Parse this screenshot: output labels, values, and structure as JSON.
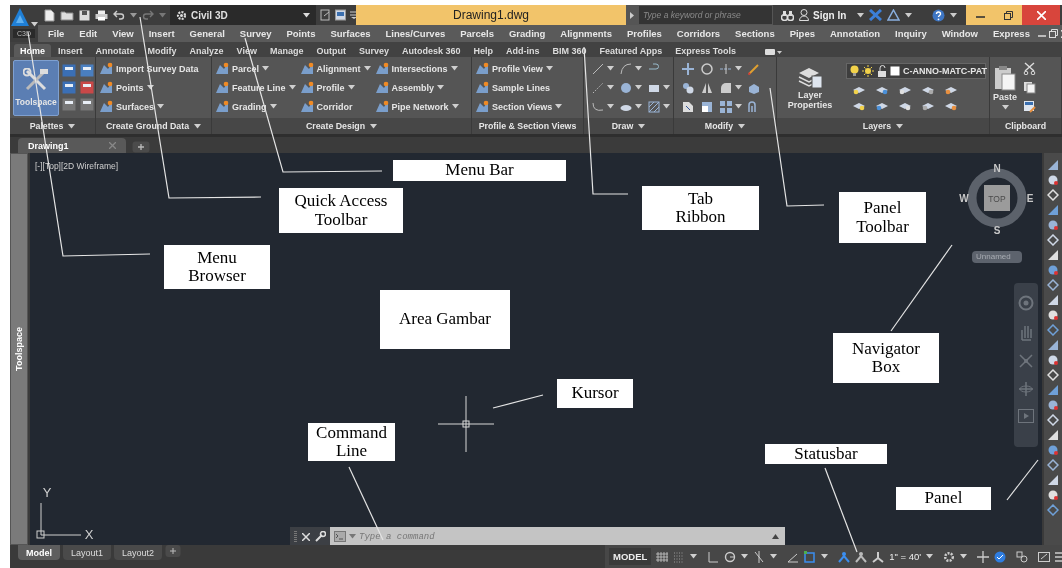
{
  "title_bar": {
    "app_badge": "C3D",
    "workspace": "Civil 3D",
    "title": "Drawing1.dwg",
    "search": {
      "placeholder": "Type a keyword or phrase"
    },
    "sign_in": "Sign In"
  },
  "menu_bar": [
    "File",
    "Edit",
    "View",
    "Insert",
    "General",
    "Survey",
    "Points",
    "Surfaces",
    "Lines/Curves",
    "Parcels",
    "Grading",
    "Alignments",
    "Profiles",
    "Corridors",
    "Sections",
    "Pipes",
    "Annotation",
    "Inquiry",
    "Window",
    "Express"
  ],
  "ribbon": {
    "tabs": [
      {
        "label": "Home",
        "selected": true
      },
      {
        "label": "Insert",
        "selected": false
      },
      {
        "label": "Annotate",
        "selected": false
      },
      {
        "label": "Modify",
        "selected": false
      },
      {
        "label": "Analyze",
        "selected": false
      },
      {
        "label": "View",
        "selected": false
      },
      {
        "label": "Manage",
        "selected": false
      },
      {
        "label": "Output",
        "selected": false
      },
      {
        "label": "Survey",
        "selected": false
      },
      {
        "label": "Autodesk 360",
        "selected": false
      },
      {
        "label": "Help",
        "selected": false
      },
      {
        "label": "Add-ins",
        "selected": false
      },
      {
        "label": "BIM 360",
        "selected": false
      },
      {
        "label": "Featured Apps",
        "selected": false
      },
      {
        "label": "Express Tools",
        "selected": false
      }
    ],
    "panels": [
      {
        "kind": "palettes",
        "title": "Palettes",
        "dropdown": true,
        "button": {
          "label": "Toolspace",
          "selected": true
        }
      },
      {
        "kind": "tools",
        "title": "Create Ground Data",
        "dropdown": true,
        "columns": [
          [
            {
              "label": "Import Survey Data",
              "dropdown": false
            },
            {
              "label": "Points",
              "dropdown": true
            },
            {
              "label": "Surfaces",
              "dropdown": true
            }
          ]
        ]
      },
      {
        "kind": "tools",
        "title": "Create Design",
        "dropdown": true,
        "columns": [
          [
            {
              "label": "Parcel",
              "dropdown": true
            },
            {
              "label": "Feature Line",
              "dropdown": true
            },
            {
              "label": "Grading",
              "dropdown": true
            }
          ],
          [
            {
              "label": "Alignment",
              "dropdown": true
            },
            {
              "label": "Profile",
              "dropdown": true
            },
            {
              "label": "Corridor",
              "dropdown": false
            }
          ],
          [
            {
              "label": "Intersections",
              "dropdown": true
            },
            {
              "label": "Assembly",
              "dropdown": true
            },
            {
              "label": "Pipe Network",
              "dropdown": true
            }
          ]
        ]
      },
      {
        "kind": "tools",
        "title": "Profile & Section Views",
        "dropdown": false,
        "columns": [
          [
            {
              "label": "Profile View",
              "dropdown": true
            },
            {
              "label": "Sample Lines",
              "dropdown": false
            },
            {
              "label": "Section Views",
              "dropdown": true
            }
          ]
        ]
      },
      {
        "kind": "icons",
        "title": "Draw",
        "dropdown": true
      },
      {
        "kind": "icons",
        "title": "Modify",
        "dropdown": true
      },
      {
        "kind": "layers",
        "title": "Layers",
        "dropdown": true,
        "button": {
          "label": "Layer Properties"
        },
        "layer": {
          "name": "C-ANNO-MATC-PAT"
        }
      },
      {
        "kind": "clipboard",
        "title": "Clipboard",
        "dropdown": false,
        "button": {
          "label": "Paste",
          "dropdown": true
        }
      }
    ]
  },
  "document_tabs": [
    {
      "label": "Drawing1",
      "selected": true
    }
  ],
  "toolspace": {
    "label": "Toolspace"
  },
  "viewport": {
    "label": "[-][Top][2D Wireframe]",
    "view_cube": {
      "north": "N",
      "west": "W",
      "face": "TOP",
      "east": "E",
      "south": "S",
      "view": "Unnamed"
    },
    "ucs": {
      "x": "X",
      "y": "Y"
    }
  },
  "command_line": {
    "placeholder": "Type a command"
  },
  "layout_tabs": [
    {
      "label": "Model",
      "selected": true
    },
    {
      "label": "Layout1",
      "selected": false
    },
    {
      "label": "Layout2",
      "selected": false
    }
  ],
  "status_bar": {
    "mode": "MODEL",
    "scale": "1\" = 40'"
  },
  "annotations": [
    {
      "text": "Menu Bar"
    },
    {
      "text": "Quick Access Toolbar"
    },
    {
      "text": "Tab Ribbon"
    },
    {
      "text": "Panel Toolbar"
    },
    {
      "text": "Menu Browser"
    },
    {
      "text": "Area Gambar"
    },
    {
      "text": "Navigator Box"
    },
    {
      "text": "Kursor"
    },
    {
      "text": "Command Line"
    },
    {
      "text": "Statusbar"
    },
    {
      "text": "Panel"
    }
  ]
}
